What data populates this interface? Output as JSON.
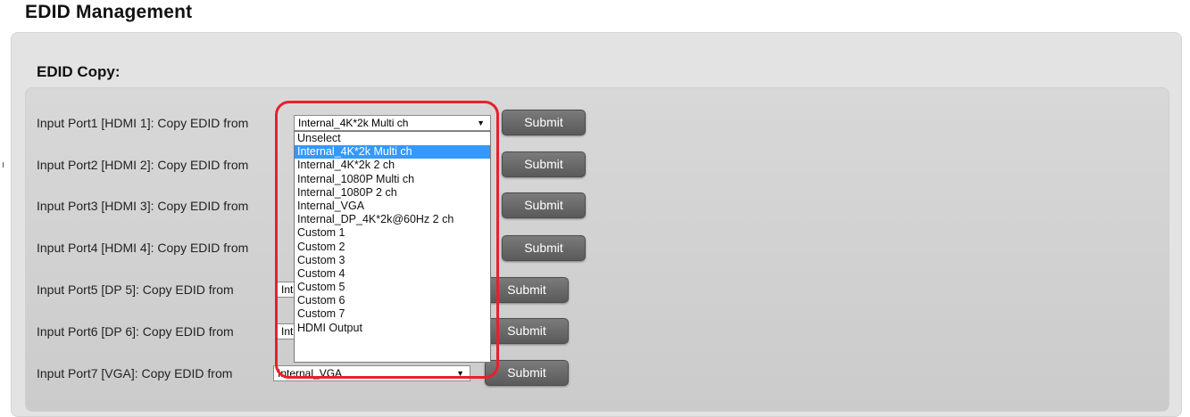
{
  "page": {
    "title": "EDID Management"
  },
  "section": {
    "title": "EDID Copy:"
  },
  "colors": {
    "highlight": "#e8202a",
    "selected_option": "#3399ff",
    "button": "#6a6a6a"
  },
  "rows": [
    {
      "label": "Input Port1 [HDMI 1]: Copy EDID from",
      "selected": "Internal_4K*2k Multi ch",
      "submit": "Submit"
    },
    {
      "label": "Input Port2 [HDMI 2]: Copy EDID from",
      "selected": "",
      "submit": "Submit"
    },
    {
      "label": "Input Port3 [HDMI 3]: Copy EDID from",
      "selected": "",
      "submit": "Submit"
    },
    {
      "label": "Input Port4 [HDMI 4]: Copy EDID from",
      "selected": "",
      "submit": "Submit"
    },
    {
      "label": "Input Port5 [DP 5]: Copy EDID from",
      "selected": "Int",
      "submit": "Submit"
    },
    {
      "label": "Input Port6 [DP 6]: Copy EDID from",
      "selected": "Int",
      "submit": "Submit"
    },
    {
      "label": "Input Port7 [VGA]: Copy EDID from",
      "selected": "Internal_VGA",
      "submit": "Submit"
    }
  ],
  "dropdown": {
    "options": [
      "Unselect",
      "Internal_4K*2k Multi ch",
      "Internal_4K*2k 2 ch",
      "Internal_1080P Multi ch",
      "Internal_1080P 2 ch",
      "Internal_VGA",
      "Internal_DP_4K*2k@60Hz 2 ch",
      "Custom 1",
      "Custom 2",
      "Custom 3",
      "Custom 4",
      "Custom 5",
      "Custom 6",
      "Custom 7",
      "HDMI Output"
    ],
    "selected_index": 1
  },
  "icons": {
    "dropdown_arrow": "chevron-down-icon"
  }
}
